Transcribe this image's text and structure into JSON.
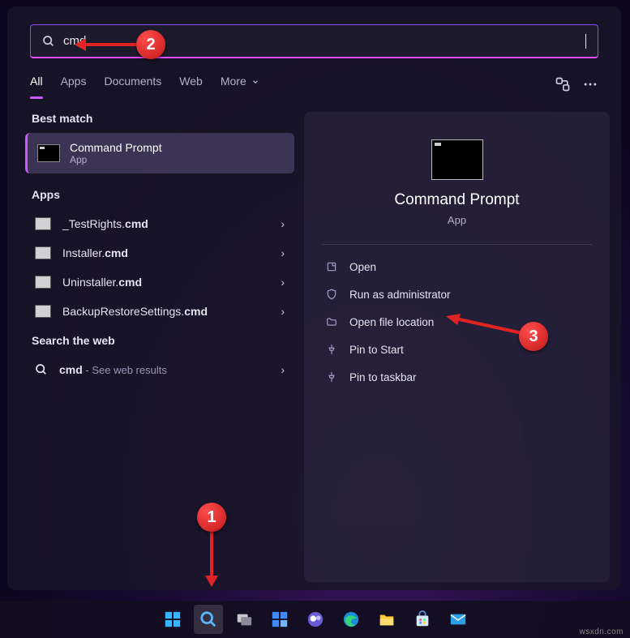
{
  "search": {
    "value": "cmd"
  },
  "tabs": {
    "items": [
      {
        "label": "All",
        "active": true
      },
      {
        "label": "Apps",
        "active": false
      },
      {
        "label": "Documents",
        "active": false
      },
      {
        "label": "Web",
        "active": false
      },
      {
        "label": "More",
        "active": false
      }
    ]
  },
  "sections": {
    "best_match": "Best match",
    "apps": "Apps",
    "search_web": "Search the web"
  },
  "best": {
    "title": "Command Prompt",
    "subtitle": "App"
  },
  "app_items": [
    {
      "prefix": "_TestRights.",
      "bold": "cmd"
    },
    {
      "prefix": "Installer.",
      "bold": "cmd"
    },
    {
      "prefix": "Uninstaller.",
      "bold": "cmd"
    },
    {
      "prefix": "BackupRestoreSettings.",
      "bold": "cmd"
    }
  ],
  "web_item": {
    "term": "cmd",
    "suffix": " - See web results"
  },
  "preview": {
    "title": "Command Prompt",
    "subtitle": "App"
  },
  "actions": [
    {
      "icon": "open-icon",
      "label": "Open"
    },
    {
      "icon": "shield-icon",
      "label": "Run as administrator"
    },
    {
      "icon": "folder-icon",
      "label": "Open file location"
    },
    {
      "icon": "pin-icon",
      "label": "Pin to Start"
    },
    {
      "icon": "pin-icon",
      "label": "Pin to taskbar"
    }
  ],
  "callouts": {
    "c1": "1",
    "c2": "2",
    "c3": "3"
  },
  "watermark": "wsxdn.com"
}
